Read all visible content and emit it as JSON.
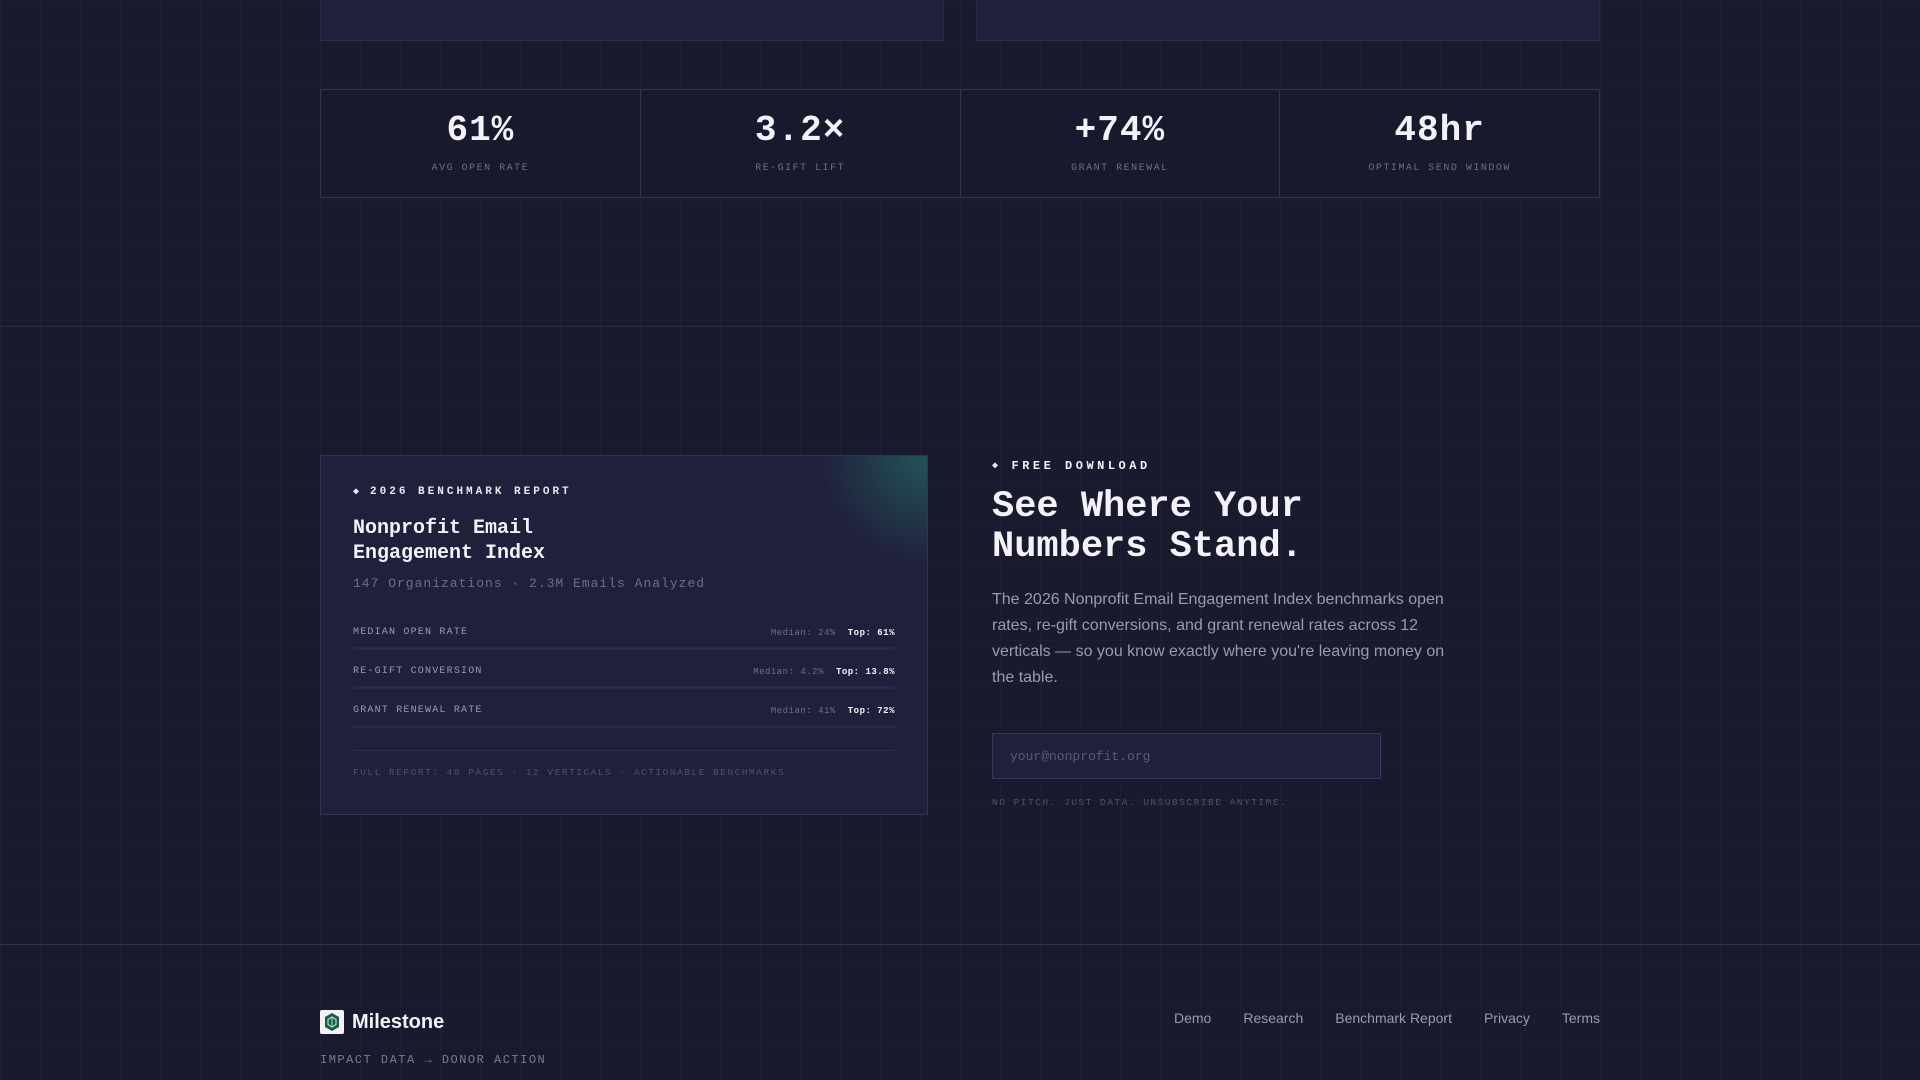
{
  "stats": [
    {
      "value": "61%",
      "label": "AVG OPEN RATE"
    },
    {
      "value": "3.2×",
      "label": "RE-GIFT LIFT"
    },
    {
      "value": "+74%",
      "label": "GRANT RENEWAL"
    },
    {
      "value": "48hr",
      "label": "OPTIMAL SEND WINDOW"
    }
  ],
  "report": {
    "tag": "2026 BENCHMARK REPORT",
    "title": "Nonprofit Email Engagement Index",
    "subtitle": "147 Organizations · 2.3M Emails Analyzed",
    "metrics": [
      {
        "name": "MEDIAN OPEN RATE",
        "median": "Median: 24%",
        "top": "Top: 61%"
      },
      {
        "name": "RE-GIFT CONVERSION",
        "median": "Median: 4.2%",
        "top": "Top: 13.8%"
      },
      {
        "name": "GRANT RENEWAL RATE",
        "median": "Median: 41%",
        "top": "Top: 72%"
      }
    ],
    "footer": "FULL REPORT: 48 PAGES · 12 VERTICALS · ACTIONABLE BENCHMARKS"
  },
  "download": {
    "tag": "FREE DOWNLOAD",
    "title": "See Where Your Numbers Stand.",
    "description": "The 2026 Nonprofit Email Engagement Index benchmarks open rates, re-gift conversions, and grant renewal rates across 12 verticals — so you know exactly where you're leaving money on the table.",
    "email_placeholder": "your@nonprofit.org",
    "email_value": "",
    "note": "NO PITCH. JUST DATA. UNSUBSCRIBE ANYTIME."
  },
  "footer": {
    "brand": "Milestone",
    "tagline": "IMPACT DATA → DONOR ACTION",
    "links": [
      "Demo",
      "Research",
      "Benchmark Report",
      "Privacy",
      "Terms"
    ]
  },
  "colors": {
    "background": "#1a1a2e",
    "card": "#20203c",
    "accent_glow": "#28b48c",
    "text": "#f2f2f8",
    "muted": "#6e6e88"
  },
  "icons": {
    "diamond": "diamond-icon",
    "logo": "milestone-logo-icon"
  }
}
